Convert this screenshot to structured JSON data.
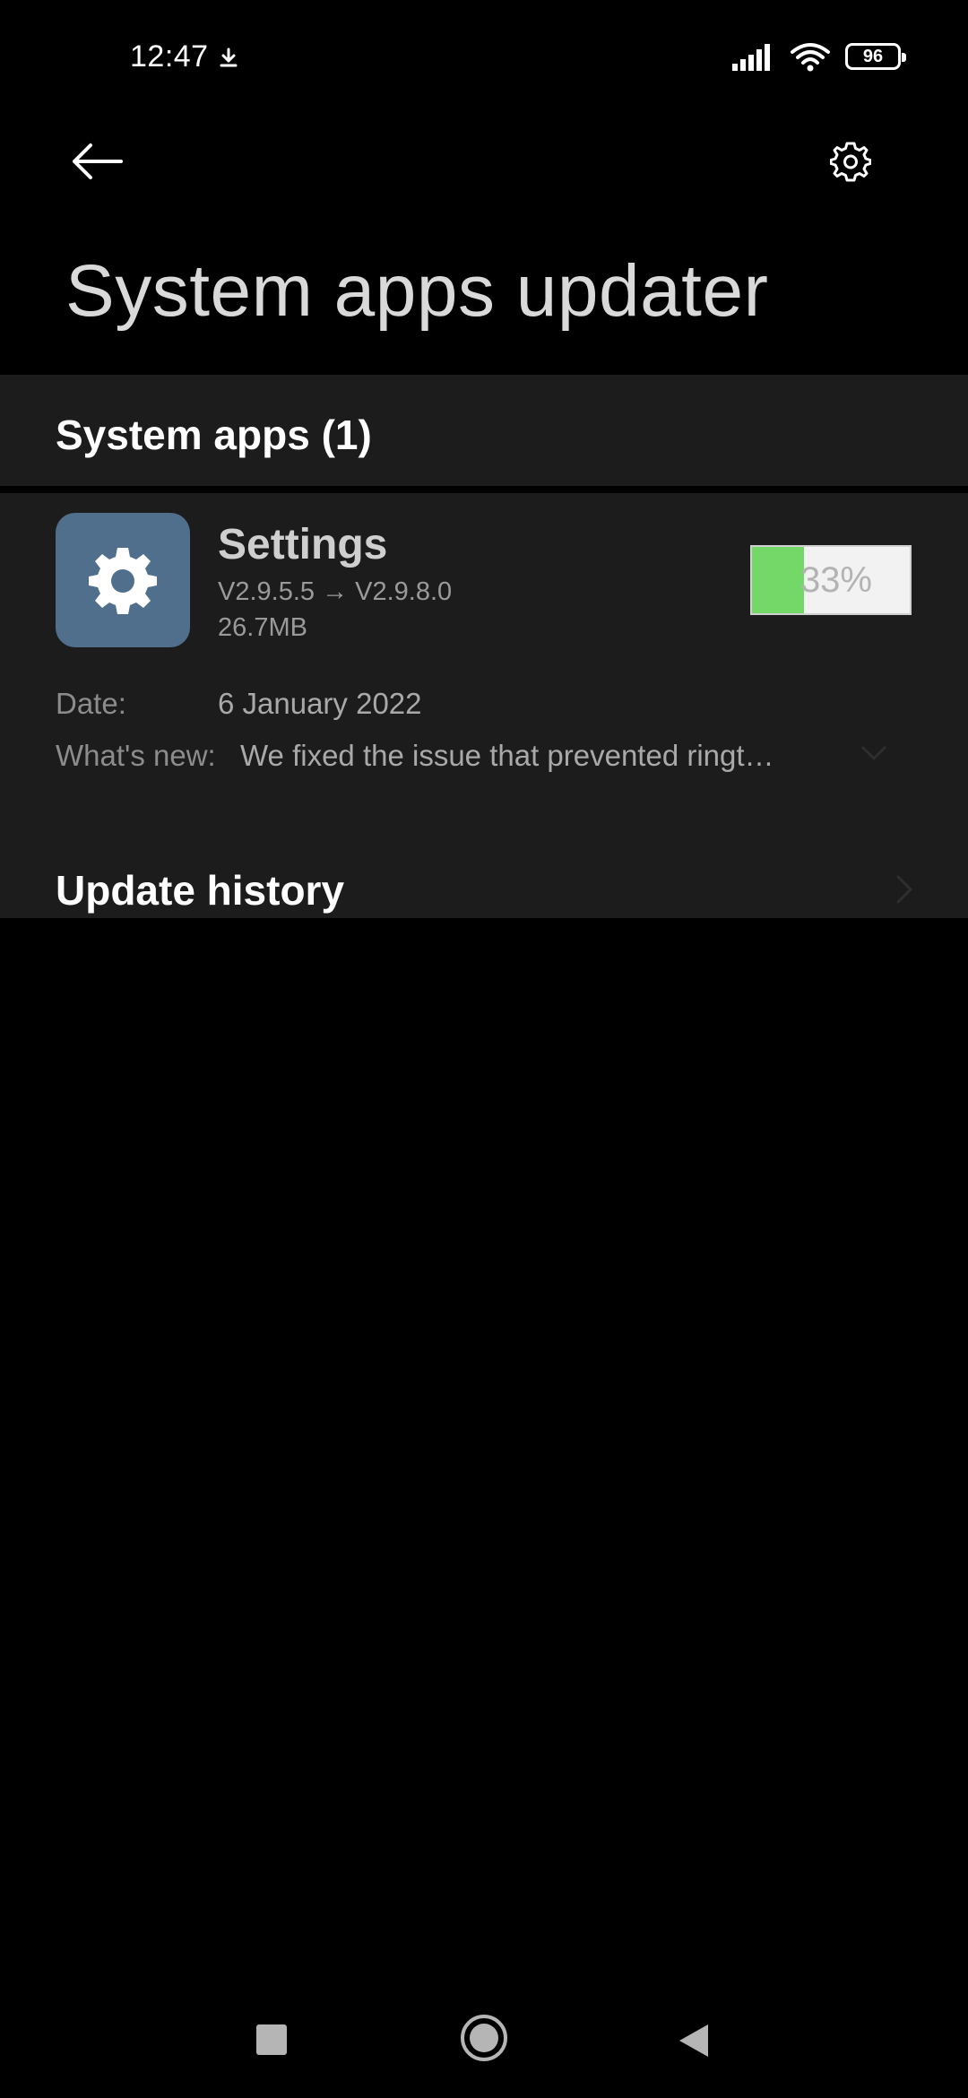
{
  "status_bar": {
    "time": "12:47",
    "battery_level": "96",
    "icons": [
      "download-icon",
      "signal-icon",
      "wifi-icon",
      "battery-icon"
    ]
  },
  "header": {
    "title": "System apps updater",
    "icons": [
      "back-arrow-icon",
      "settings-gear-icon"
    ]
  },
  "section": {
    "label": "System apps (1)"
  },
  "app": {
    "name": "Settings",
    "version": "V2.9.5.5 → V2.9.8.0",
    "size": "26.7MB",
    "progress_text": "33%",
    "progress_fraction": 0.33,
    "date_label": "Date:",
    "date_value": "6 January 2022",
    "whats_new_label": "What's new:",
    "whats_new_value": "We fixed the issue that prevented ringt…"
  },
  "history": {
    "label": "Update history"
  },
  "colors": {
    "background": "#000000",
    "card": "#1c1c1c",
    "app_icon_bg": "#4f6f8c",
    "progress_fill": "#74d869"
  }
}
